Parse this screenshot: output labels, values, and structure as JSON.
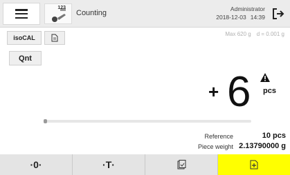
{
  "header": {
    "app_title": "Counting",
    "app_icon_superscript": "123",
    "user": "Administrator",
    "date": "2018-12-03",
    "time": "14:39"
  },
  "toolbar": {
    "isocal_label": "isoCAL",
    "qnt_label": "Qnt",
    "max_label": "Max 620 g",
    "d_label": "d = 0.001 g"
  },
  "display": {
    "sign": "+",
    "value": "6",
    "unit": "pcs"
  },
  "progress": {
    "fraction": 0.0
  },
  "info": {
    "reference_label": "Reference",
    "reference_value": "10 pcs",
    "piece_weight_label": "Piece weight",
    "piece_weight_value": "2.13790000 g"
  },
  "bottom": {
    "zero_label": "·0·",
    "tare_label": "·T·",
    "icons": [
      "clipboard-check-icon",
      "add-document-icon"
    ],
    "accent_color": "#ffff00"
  }
}
